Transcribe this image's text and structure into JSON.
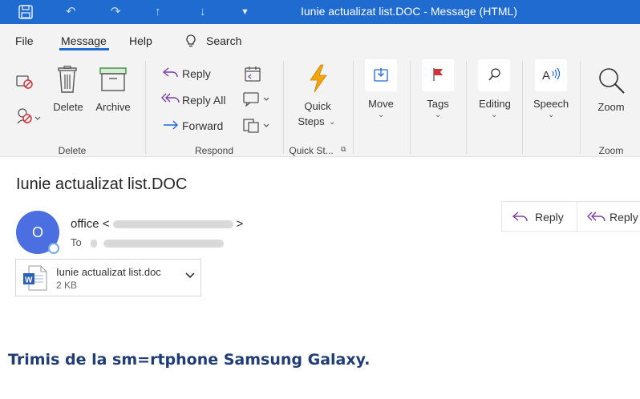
{
  "window": {
    "title": "Iunie actualizat list.DOC  -  Message (HTML)"
  },
  "menu": {
    "items": [
      "File",
      "Message",
      "Help"
    ],
    "search_label": "Search"
  },
  "ribbon": {
    "delete_group": {
      "delete_label": "Delete",
      "archive_label": "Archive",
      "group_label": "Delete"
    },
    "respond_group": {
      "reply_label": "Reply",
      "reply_all_label": "Reply All",
      "forward_label": "Forward",
      "group_label": "Respond"
    },
    "quick_steps_group": {
      "label_line1": "Quick",
      "label_line2": "Steps",
      "group_label": "Quick St..."
    },
    "move_label": "Move",
    "tags_label": "Tags",
    "editing_label": "Editing",
    "speech_label": "Speech",
    "zoom_group": {
      "zoom_label": "Zoom",
      "group_label": "Zoom"
    }
  },
  "message": {
    "subject": "Iunie actualizat list.DOC",
    "avatar_initial": "O",
    "sender_name": "office <",
    "sender_close": ">",
    "to_label": "To",
    "reply_label": "Reply",
    "reply_all_label": "Reply",
    "attachment": {
      "name": "Iunie actualizat list.doc",
      "size": "2 KB",
      "type_badge": "W"
    },
    "body": "Trimis de la sm=rtphone Samsung Galaxy."
  },
  "colors": {
    "titlebar": "#1f6bd0",
    "ribbon_bg": "#f3f3f3",
    "avatar": "#4b6ee0",
    "body_text": "#1f3d74",
    "tag_flag": "#d13438",
    "quick_steps": "#f2a60c"
  }
}
